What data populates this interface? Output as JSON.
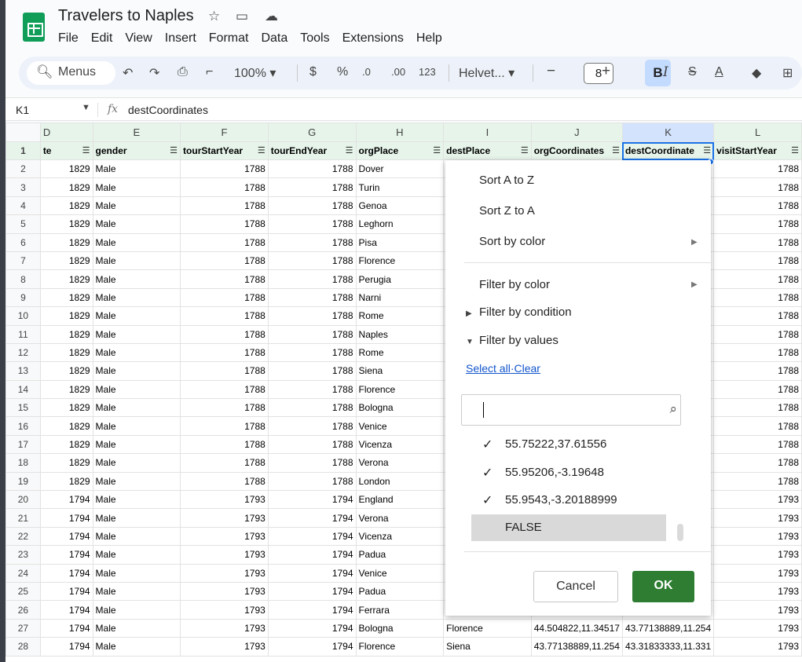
{
  "app": {
    "title": "Travelers to Naples"
  },
  "menu": [
    "File",
    "Edit",
    "View",
    "Insert",
    "Format",
    "Data",
    "Tools",
    "Extensions",
    "Help"
  ],
  "toolbar": {
    "menus_label": "Menus",
    "zoom": "100%",
    "currency": "$",
    "percent": "%",
    "dec_decrease": ".0",
    "dec_increase": ".00",
    "number_format": "123",
    "font": "Helvet...",
    "font_size": "8",
    "bold": "B",
    "italic": "I"
  },
  "formula": {
    "cell_ref": "K1",
    "fx": "fx",
    "value": "destCoordinates"
  },
  "columns": [
    "D",
    "E",
    "F",
    "G",
    "H",
    "I",
    "J",
    "K",
    "L"
  ],
  "header_row": {
    "num": "1",
    "cells": [
      "te",
      "gender",
      "tourStartYear",
      "tourEndYear",
      "orgPlace",
      "destPlace",
      "orgCoordinates",
      "destCoordinate",
      "visitStartYear"
    ]
  },
  "rows": [
    {
      "num": "2",
      "cells": [
        "1829",
        "Male",
        "1788",
        "1788",
        "Dover",
        "",
        "",
        "",
        "1788"
      ]
    },
    {
      "num": "3",
      "cells": [
        "1829",
        "Male",
        "1788",
        "1788",
        "Turin",
        "",
        "",
        "",
        "1788"
      ]
    },
    {
      "num": "4",
      "cells": [
        "1829",
        "Male",
        "1788",
        "1788",
        "Genoa",
        "",
        "",
        "",
        "1788"
      ]
    },
    {
      "num": "5",
      "cells": [
        "1829",
        "Male",
        "1788",
        "1788",
        "Leghorn",
        "",
        "",
        "",
        "1788"
      ]
    },
    {
      "num": "6",
      "cells": [
        "1829",
        "Male",
        "1788",
        "1788",
        "Pisa",
        "",
        "",
        "",
        "1788"
      ]
    },
    {
      "num": "7",
      "cells": [
        "1829",
        "Male",
        "1788",
        "1788",
        "Florence",
        "",
        "",
        "",
        "1788"
      ]
    },
    {
      "num": "8",
      "cells": [
        "1829",
        "Male",
        "1788",
        "1788",
        "Perugia",
        "",
        "",
        "",
        "1788"
      ]
    },
    {
      "num": "9",
      "cells": [
        "1829",
        "Male",
        "1788",
        "1788",
        "Narni",
        "",
        "",
        "",
        "1788"
      ]
    },
    {
      "num": "10",
      "cells": [
        "1829",
        "Male",
        "1788",
        "1788",
        "Rome",
        "",
        "",
        "",
        "1788"
      ]
    },
    {
      "num": "11",
      "cells": [
        "1829",
        "Male",
        "1788",
        "1788",
        "Naples",
        "",
        "",
        "",
        "1788"
      ]
    },
    {
      "num": "12",
      "cells": [
        "1829",
        "Male",
        "1788",
        "1788",
        "Rome",
        "",
        "",
        "",
        "1788"
      ]
    },
    {
      "num": "13",
      "cells": [
        "1829",
        "Male",
        "1788",
        "1788",
        "Siena",
        "",
        "",
        "",
        "1788"
      ]
    },
    {
      "num": "14",
      "cells": [
        "1829",
        "Male",
        "1788",
        "1788",
        "Florence",
        "",
        "",
        "",
        "1788"
      ]
    },
    {
      "num": "15",
      "cells": [
        "1829",
        "Male",
        "1788",
        "1788",
        "Bologna",
        "",
        "",
        "",
        "1788"
      ]
    },
    {
      "num": "16",
      "cells": [
        "1829",
        "Male",
        "1788",
        "1788",
        "Venice",
        "",
        "",
        "",
        "1788"
      ]
    },
    {
      "num": "17",
      "cells": [
        "1829",
        "Male",
        "1788",
        "1788",
        "Vicenza",
        "",
        "",
        "",
        "1788"
      ]
    },
    {
      "num": "18",
      "cells": [
        "1829",
        "Male",
        "1788",
        "1788",
        "Verona",
        "",
        "",
        "",
        "1788"
      ]
    },
    {
      "num": "19",
      "cells": [
        "1829",
        "Male",
        "1788",
        "1788",
        "London",
        "",
        "",
        "",
        "1788"
      ]
    },
    {
      "num": "20",
      "cells": [
        "1794",
        "Male",
        "1793",
        "1794",
        "England",
        "",
        "",
        "",
        "1793"
      ]
    },
    {
      "num": "21",
      "cells": [
        "1794",
        "Male",
        "1793",
        "1794",
        "Verona",
        "",
        "",
        "",
        "1793"
      ]
    },
    {
      "num": "22",
      "cells": [
        "1794",
        "Male",
        "1793",
        "1794",
        "Vicenza",
        "",
        "",
        "",
        "1793"
      ]
    },
    {
      "num": "23",
      "cells": [
        "1794",
        "Male",
        "1793",
        "1794",
        "Padua",
        "",
        "",
        "",
        "1793"
      ]
    },
    {
      "num": "24",
      "cells": [
        "1794",
        "Male",
        "1793",
        "1794",
        "Venice",
        "",
        "",
        "",
        "1793"
      ]
    },
    {
      "num": "25",
      "cells": [
        "1794",
        "Male",
        "1793",
        "1794",
        "Padua",
        "",
        "",
        "",
        "1793"
      ]
    },
    {
      "num": "26",
      "cells": [
        "1794",
        "Male",
        "1793",
        "1794",
        "Ferrara",
        "",
        "",
        "",
        "1793"
      ]
    },
    {
      "num": "27",
      "cells": [
        "1794",
        "Male",
        "1793",
        "1794",
        "Bologna",
        "Florence",
        "44.504822,11.34517",
        "43.77138889,11.254",
        "1793"
      ]
    },
    {
      "num": "28",
      "cells": [
        "1794",
        "Male",
        "1793",
        "1794",
        "Florence",
        "Siena",
        "43.77138889,11.254",
        "43.31833333,11.331",
        "1793"
      ]
    }
  ],
  "filter_menu": {
    "sort_az": "Sort A to Z",
    "sort_za": "Sort Z to A",
    "sort_color": "Sort by color",
    "filter_color": "Filter by color",
    "filter_condition": "Filter by condition",
    "filter_values": "Filter by values",
    "select_all": "Select all",
    "sep": "·",
    "clear": "Clear",
    "values": [
      "55.75222,37.61556",
      "55.95206,-3.19648",
      "55.9543,-3.20188999",
      "FALSE"
    ],
    "cancel": "Cancel",
    "ok": "OK"
  }
}
